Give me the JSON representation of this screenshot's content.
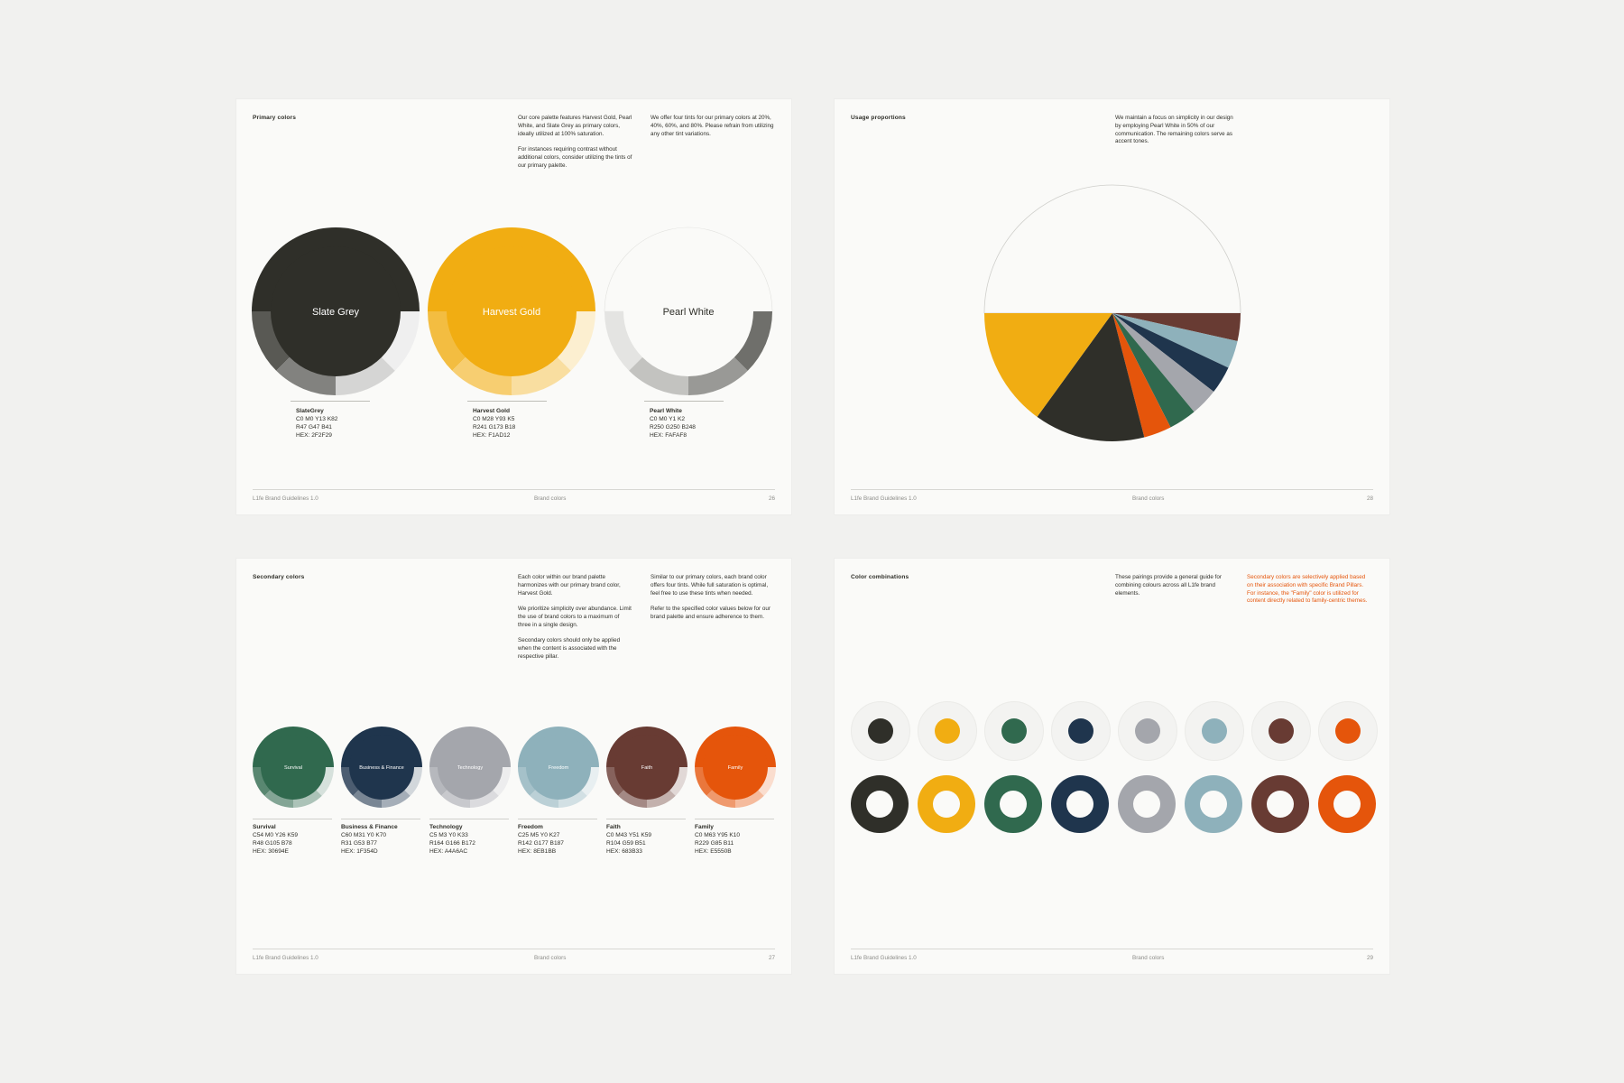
{
  "brand": {
    "colors": {
      "slate_grey": "#2F2F29",
      "harvest_gold": "#F1AD12",
      "pearl_white": "#FAFAF8",
      "survival": "#30694E",
      "business_finance": "#1F354D",
      "technology": "#A4A6AC",
      "freedom": "#8EB1BB",
      "faith": "#683B33",
      "family": "#E5550B",
      "page_bg": "#F1F1EF",
      "accent_text": "#E5550B"
    }
  },
  "pages": {
    "primary": {
      "heading": "Primary colors",
      "intro_col1": [
        "Our core palette features Harvest Gold, Pearl White, and Slate Grey as primary colors, ideally utilized at 100% saturation.",
        "For instances requiring contrast without additional colors, consider utilizing the tints of our primary palette."
      ],
      "intro_col2": [
        "We offer four tints for our primary colors at 20%, 40%, 60%, and 80%. Please refrain from utilizing any other tint variations."
      ],
      "swatches": [
        {
          "label": "Slate Grey",
          "name": "SlateGrey",
          "cmyk": "C0 M0 Y13 K82",
          "rgb": "R47 G47 B41",
          "hex": "HEX: 2F2F29"
        },
        {
          "label": "Harvest Gold",
          "name": "Harvest Gold",
          "cmyk": "C0 M28 Y93 K5",
          "rgb": "R241 G173 B18",
          "hex": "HEX: F1AD12"
        },
        {
          "label": "Pearl White",
          "name": "Pearl White",
          "cmyk": "C0 M0 Y1 K2",
          "rgb": "R250 G250 B248",
          "hex": "HEX: FAFAF8"
        }
      ],
      "footer": {
        "left": "L1fe Brand Guidelines 1.0",
        "mid": "Brand colors",
        "page": "26"
      }
    },
    "usage": {
      "heading": "Usage proportions",
      "intro": [
        "We maintain a focus on simplicity in our design by employing Pearl White in 50% of our communication. The remaining colors serve as accent tones."
      ],
      "footer": {
        "left": "L1fe Brand Guidelines 1.0",
        "mid": "Brand colors",
        "page": "28"
      }
    },
    "secondary": {
      "heading": "Secondary colors",
      "intro_col1": [
        "Each color within our brand palette harmonizes with our primary brand color, Harvest Gold.",
        "We prioritize simplicity over abundance. Limit the use of brand colors to a maximum of three in a single design.",
        "Secondary colors should only be applied when the content is associated with the respective pillar."
      ],
      "intro_col2": [
        "Similar to our primary colors, each brand color offers four tints. While full saturation is optimal, feel free to use these tints when needed.",
        "Refer to the specified color values below for our brand palette and ensure adherence to them."
      ],
      "swatches": [
        {
          "label": "Survival",
          "name": "Survival",
          "cmyk": "C54 M0 Y26 K59",
          "rgb": "R48 G105 B78",
          "hex": "HEX: 30694E"
        },
        {
          "label": "Business & Finance",
          "name": "Business & Finance",
          "cmyk": "C60 M31 Y0 K70",
          "rgb": "R31 G53 B77",
          "hex": "HEX: 1F354D"
        },
        {
          "label": "Technology",
          "name": "Technology",
          "cmyk": "C5 M3 Y0 K33",
          "rgb": "R164 G166 B172",
          "hex": "HEX: A4A6AC"
        },
        {
          "label": "Freedom",
          "name": "Freedom",
          "cmyk": "C25 M5 Y0 K27",
          "rgb": "R142 G177 B187",
          "hex": "HEX: 8EB1BB"
        },
        {
          "label": "Faith",
          "name": "Faith",
          "cmyk": "C0 M43 Y51 K59",
          "rgb": "R104 G59 B51",
          "hex": "HEX: 683B33"
        },
        {
          "label": "Family",
          "name": "Family",
          "cmyk": "C0 M63 Y95 K10",
          "rgb": "R229 G85 B11",
          "hex": "HEX: E5550B"
        }
      ],
      "footer": {
        "left": "L1fe Brand Guidelines 1.0",
        "mid": "Brand colors",
        "page": "27"
      }
    },
    "combinations": {
      "heading": "Color combinations",
      "intro": [
        "These pairings provide a general guide for combining colours across all L1fe brand elements."
      ],
      "intro_accent": [
        "Secondary colors are selectively applied based on their association with specific Brand Pillars. For instance, the \"Family\" color is utilized for content directly related to family-centric themes."
      ],
      "footer": {
        "left": "L1fe Brand Guidelines 1.0",
        "mid": "Brand colors",
        "page": "29"
      }
    }
  },
  "chart_data": {
    "type": "pie",
    "title": "",
    "slices": [
      {
        "color": "#FAFAF8",
        "value": 50
      },
      {
        "color": "#683B33",
        "value": 3.5
      },
      {
        "color": "#8EB1BB",
        "value": 3.5
      },
      {
        "color": "#1F354D",
        "value": 3.5
      },
      {
        "color": "#A4A6AC",
        "value": 3.5
      },
      {
        "color": "#30694E",
        "value": 3.5
      },
      {
        "color": "#E5550B",
        "value": 3.5
      },
      {
        "color": "#2F2F29",
        "value": 14
      },
      {
        "color": "#F1AD12",
        "value": 15
      }
    ]
  }
}
